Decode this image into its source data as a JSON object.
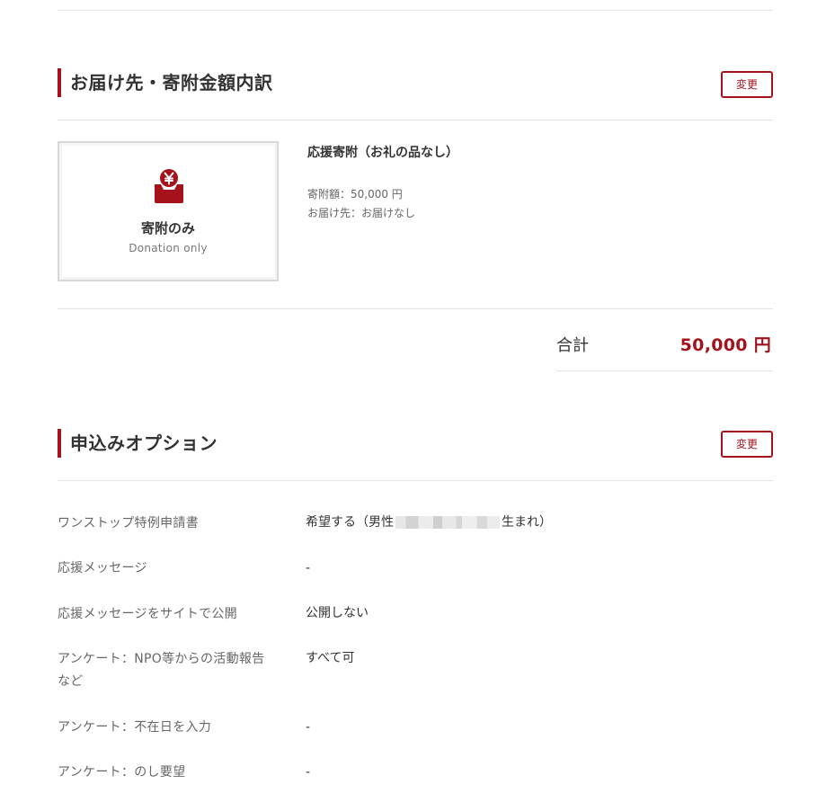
{
  "delivery_section": {
    "title": "お届け先・寄附金額内訳",
    "change_label": "変更"
  },
  "item": {
    "card_title": "寄附のみ",
    "card_subtitle": "Donation only",
    "card_icon": "yen-donation-box-icon",
    "name": "応援寄附（お礼の品なし）",
    "amount_text": "寄附額：50,000 円",
    "destination_text": "お届け先：お届けなし"
  },
  "total": {
    "label": "合計",
    "value": "50,000 円"
  },
  "options_section": {
    "title": "申込みオプション",
    "change_label": "変更",
    "rows": [
      {
        "label": "ワンストップ特例申請書",
        "value_prefix": "希望する（男性",
        "value_suffix": "生まれ）"
      },
      {
        "label": "応援メッセージ",
        "value": "-"
      },
      {
        "label": "応援メッセージをサイトで公開",
        "value": "公開しない"
      },
      {
        "label": "アンケート：NPO等からの活動報告など",
        "value": "すべて可"
      },
      {
        "label": "アンケート：不在日を入力",
        "value": "-"
      },
      {
        "label": "アンケート：のし要望",
        "value": "-"
      }
    ]
  },
  "colors": {
    "accent": "#a5121b",
    "divider": "#e3e3e3"
  }
}
